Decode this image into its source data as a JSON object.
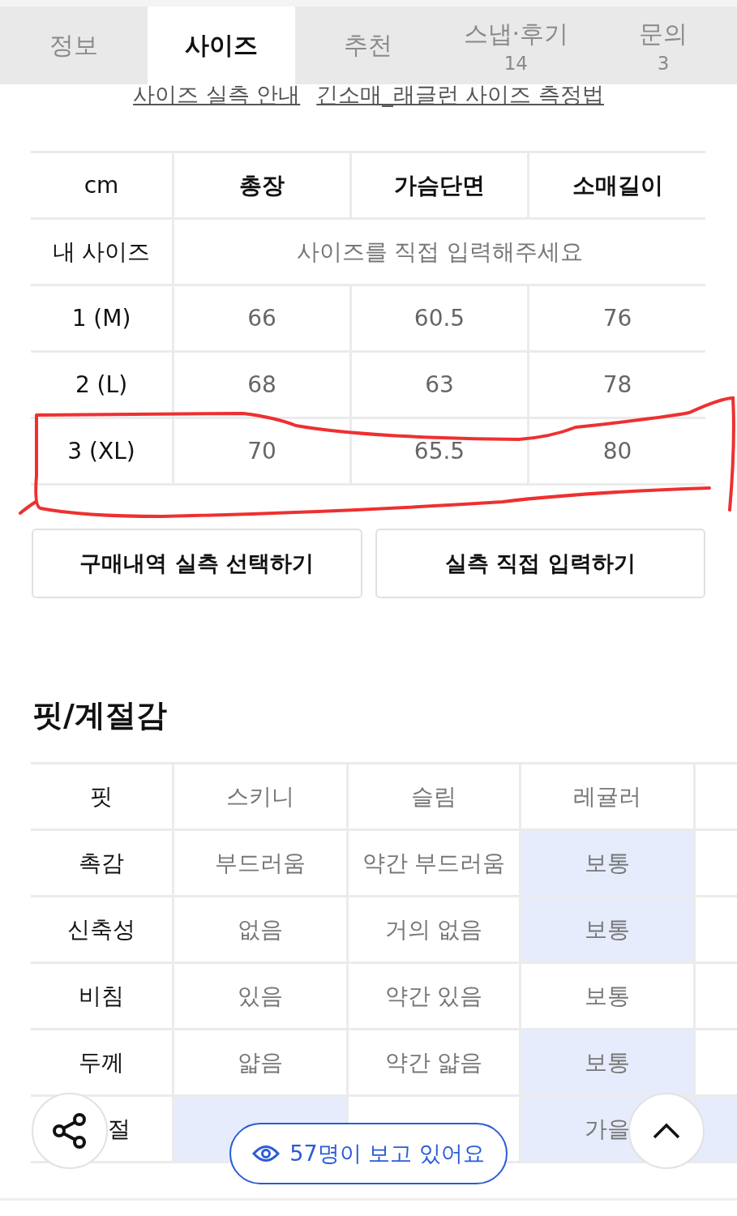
{
  "tabs": [
    {
      "label": "정보",
      "selected": false
    },
    {
      "label": "사이즈",
      "selected": true
    },
    {
      "label": "추천",
      "selected": false
    },
    {
      "label": "스냅·후기",
      "count": "14",
      "selected": false
    },
    {
      "label": "문의",
      "count": "3",
      "selected": false
    }
  ],
  "links": [
    "사이즈 실측 안내",
    "긴소매_래글런 사이즈 측정법"
  ],
  "size_table": {
    "columns": [
      "cm",
      "총장",
      "가슴단면",
      "소매길이"
    ],
    "my_size": {
      "label": "내 사이즈",
      "placeholder": "사이즈를 직접 입력해주세요"
    },
    "rows": [
      {
        "size": "1 (M)",
        "values": [
          "66",
          "60.5",
          "76"
        ],
        "annotated": false
      },
      {
        "size": "2 (L)",
        "values": [
          "68",
          "63",
          "78"
        ],
        "annotated": false
      },
      {
        "size": "3 (XL)",
        "values": [
          "70",
          "65.5",
          "80"
        ],
        "annotated": true
      }
    ]
  },
  "buttons": [
    "구매내역 실측 선택하기",
    "실측 직접 입력하기"
  ],
  "fit": {
    "title": "핏/계절감",
    "rows": [
      {
        "label": "핏",
        "cells": [
          {
            "text": "스키니",
            "selected": false
          },
          {
            "text": "슬림",
            "selected": false
          },
          {
            "text": "레귤러",
            "selected": false
          },
          {
            "selected": false
          }
        ]
      },
      {
        "label": "촉감",
        "cells": [
          {
            "text": "부드러움",
            "selected": false
          },
          {
            "text": "약간 부드러움",
            "selected": false
          },
          {
            "text": "보통",
            "selected": true
          },
          {
            "selected": false
          }
        ]
      },
      {
        "label": "신축성",
        "cells": [
          {
            "text": "없음",
            "selected": false
          },
          {
            "text": "거의 없음",
            "selected": false
          },
          {
            "text": "보통",
            "selected": true
          },
          {
            "selected": false
          }
        ]
      },
      {
        "label": "비침",
        "cells": [
          {
            "text": "있음",
            "selected": false
          },
          {
            "text": "약간 있음",
            "selected": false
          },
          {
            "text": "보통",
            "selected": false
          },
          {
            "selected": false
          }
        ]
      },
      {
        "label": "두께",
        "cells": [
          {
            "text": "얇음",
            "selected": false
          },
          {
            "text": "약간 얇음",
            "selected": false
          },
          {
            "text": "보통",
            "selected": true
          },
          {
            "selected": false
          }
        ]
      },
      {
        "label": "절",
        "cells": [
          {
            "selected": true
          },
          {
            "selected": false
          },
          {
            "text": "가을",
            "selected": true
          },
          {
            "selected": true
          }
        ]
      }
    ]
  },
  "viewers": "57명이 보고 있어요"
}
